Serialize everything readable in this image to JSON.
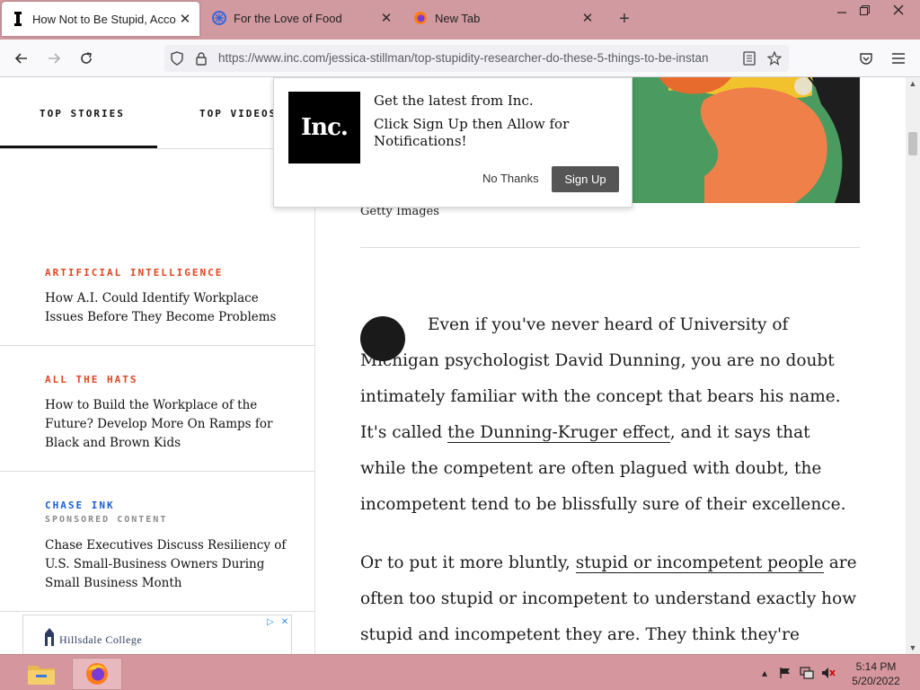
{
  "browser": {
    "tabs": [
      {
        "title": "How Not to Be Stupid, Accordin",
        "favicon": "inc-i-icon",
        "active": true
      },
      {
        "title": "For the Love of Food",
        "favicon": "blue-swirl-icon",
        "active": false
      },
      {
        "title": "New Tab",
        "favicon": "firefox-icon",
        "active": false
      }
    ],
    "url": "https://www.inc.com/jessica-stillman/top-stupidity-researcher-do-these-5-things-to-be-instan"
  },
  "sidebar": {
    "tabs": [
      "TOP STORIES",
      "TOP VIDEOS"
    ],
    "stories": [
      {
        "category": "ARTIFICIAL INTELLIGENCE",
        "headline": "How A.I. Could Identify Workplace Issues Before They Become Problems"
      },
      {
        "category": "ALL THE HATS",
        "headline": "How to Build the Workplace of the Future? Develop More On Ramps for Black and Brown Kids"
      },
      {
        "category": "CHASE INK",
        "sponsor": "SPONSORED CONTENT",
        "headline": "Chase Executives Discuss Resiliency of U.S. Small-Business Owners During Small Business Month"
      }
    ],
    "ad_label": "Hillsdale College"
  },
  "popup": {
    "logo": "Inc.",
    "title": "Get the latest from Inc.",
    "body": "Click Sign Up then Allow for Notifications!",
    "no_label": "No Thanks",
    "yes_label": "Sign Up"
  },
  "article": {
    "image_credit": "Getty Images",
    "p1_a": "Even if you've never heard of University of Michigan psychologist David Dunning, you are no doubt intimately familiar with the concept that bears his name. It's called ",
    "p1_link": "the Dunning-Kruger effect",
    "p1_b": ", and it says that while the competent are often plagued with doubt, the incompetent tend to be blissfully sure of their excellence.",
    "p2_a": "Or to put it more bluntly, ",
    "p2_link": "stupid or incompetent people",
    "p2_b": " are often too stupid or incompetent to understand exactly how stupid and incompetent they are. They think they're awesome."
  },
  "taskbar": {
    "time": "5:14 PM",
    "date": "5/20/2022"
  },
  "colors": {
    "titlebar": "#d19aa0",
    "taskbar": "#d5979d",
    "category_red": "#e0461f",
    "category_blue": "#1b5fd1"
  }
}
